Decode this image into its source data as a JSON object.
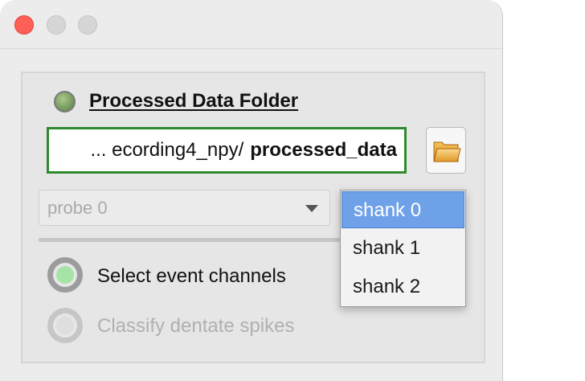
{
  "window": {
    "traffic_lights": [
      "close",
      "minimize",
      "maximize"
    ]
  },
  "folder": {
    "status_color": "#7c9e63",
    "title": "Processed Data Folder",
    "path_prefix": "... ecording4_npy/",
    "path_name": "processed_data",
    "browse_icon": "folder-open-icon",
    "field_border_color": "#2d8a2d"
  },
  "probe": {
    "selected": "probe 0"
  },
  "shank": {
    "options": [
      "shank 0",
      "shank 1",
      "shank 2"
    ],
    "selected": "shank 0",
    "highlight_color": "#6fa1e8"
  },
  "options": {
    "event_channels": "Select event channels",
    "dentate_spikes": "Classify dentate spikes",
    "event_channels_indicator_color": "#a6e3a6"
  }
}
